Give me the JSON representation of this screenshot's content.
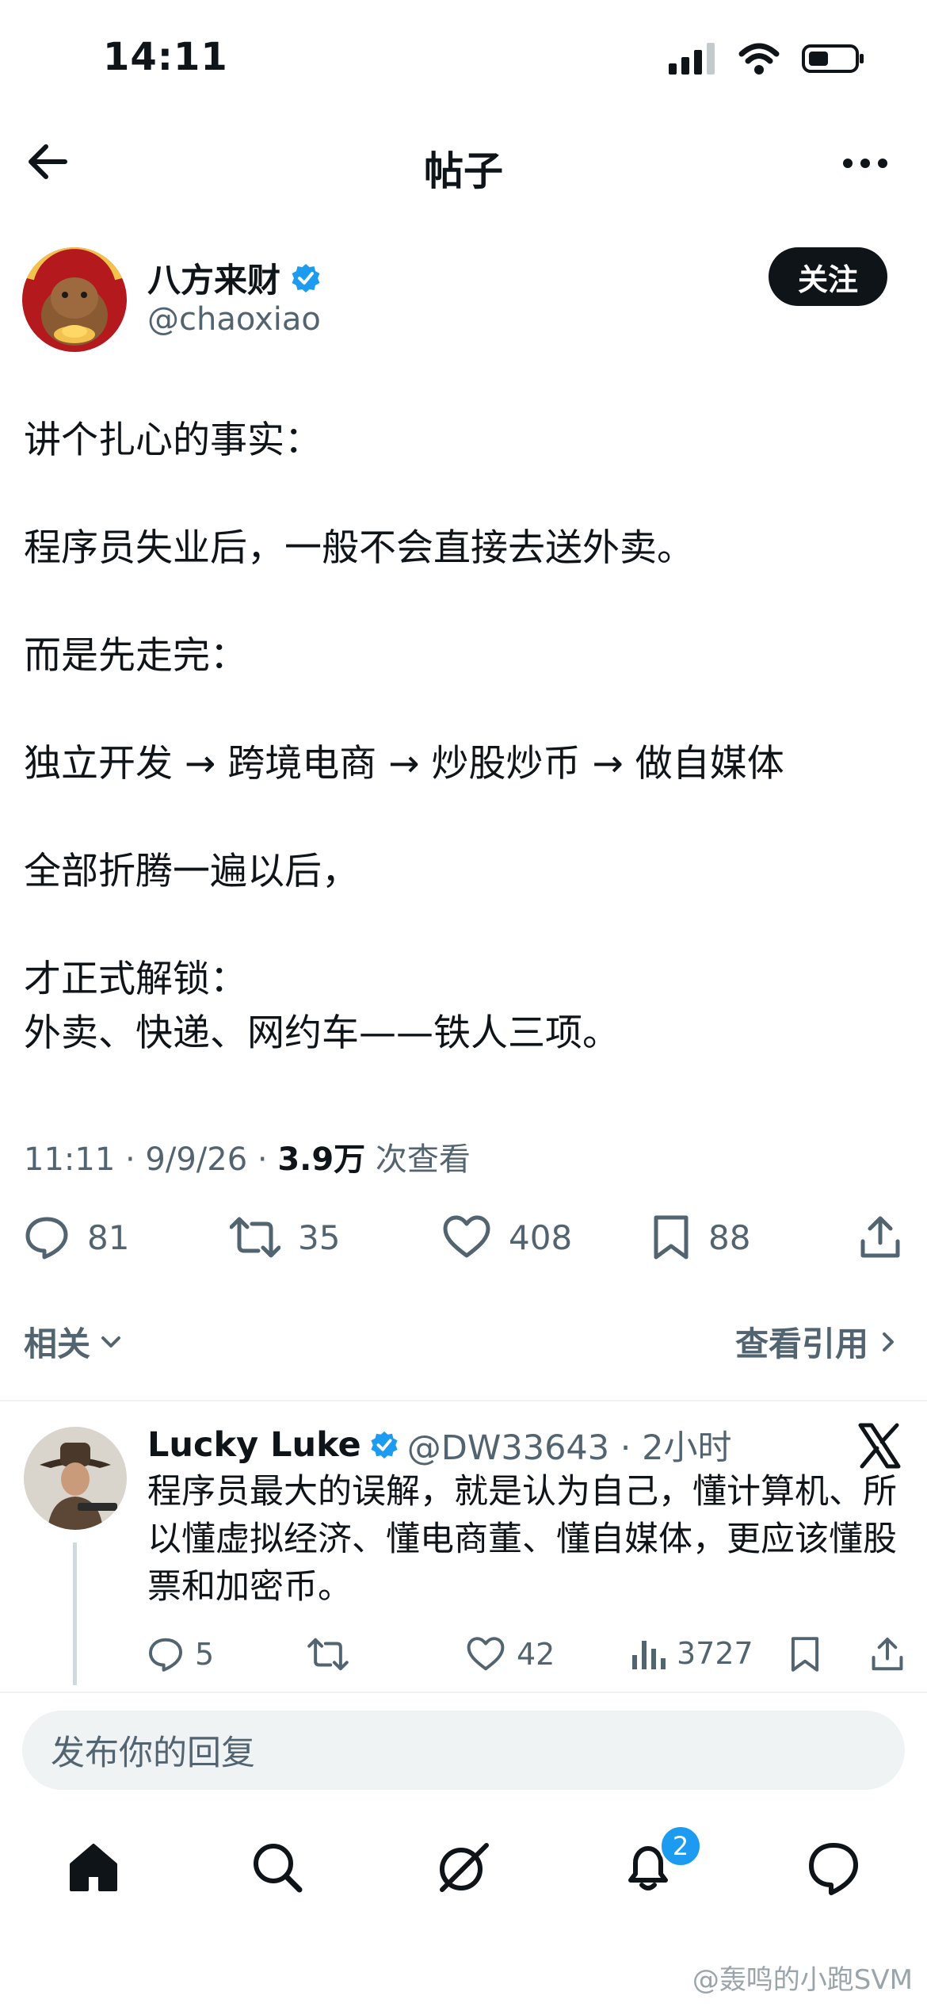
{
  "status_bar": {
    "time": "14:11"
  },
  "header": {
    "title": "帖子"
  },
  "author": {
    "name": "八方来财",
    "handle": "@chaoxiao",
    "follow_label": "关注",
    "avatar_text": "八方来财"
  },
  "tweet": {
    "line1": "讲个扎心的事实：",
    "line2": "程序员失业后，一般不会直接去送外卖。",
    "line3": "而是先走完：",
    "line4": "独立开发 → 跨境电商 → 炒股炒币 → 做自媒体",
    "line5": "全部折腾一遍以后，",
    "line6": "才正式解锁：",
    "line7": "外卖、快递、网约车——铁人三项。"
  },
  "meta": {
    "time_date": "11:11 · 9/9/26 · ",
    "views": "3.9万",
    "views_label": " 次查看"
  },
  "stats": {
    "replies": "81",
    "retweets": "35",
    "likes": "408",
    "bookmarks": "88"
  },
  "related": {
    "label": "相关",
    "view_quotes": "查看引用"
  },
  "reply": {
    "name": "Lucky Luke",
    "handle_time": "@DW33643 · 2小时",
    "text": "程序员最大的误解，就是认为自己，懂计算机、所以懂虚拟经济、懂电商董、懂自媒体，更应该懂股票和加密币。",
    "replies": "5",
    "likes": "42",
    "views": "3727"
  },
  "composer": {
    "placeholder": "发布你的回复"
  },
  "tabbar": {
    "notifications_badge": "2"
  },
  "watermark": "@轰鸣的小跑SVM",
  "colors": {
    "accent": "#1d9bf0",
    "text": "#0f1419",
    "secondary": "#536471"
  }
}
